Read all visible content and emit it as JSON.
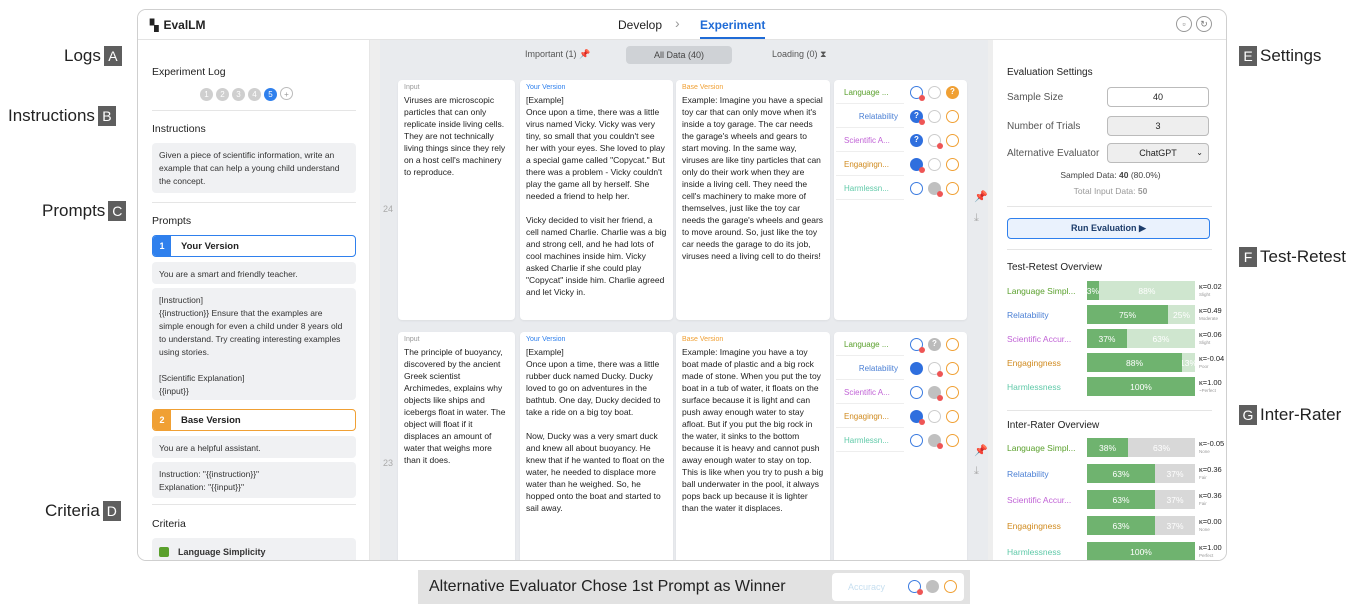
{
  "callouts": {
    "logs": {
      "label": "Logs",
      "badge": "A"
    },
    "instructions": {
      "label": "Instructions",
      "badge": "B"
    },
    "prompts": {
      "label": "Prompts",
      "badge": "C"
    },
    "criteria": {
      "label": "Criteria",
      "badge": "D"
    },
    "settings": {
      "label": "Settings",
      "badge": "E"
    },
    "testretest": {
      "label": "Test-Retest",
      "badge": "F"
    },
    "interrater": {
      "label": "Inter-Rater",
      "badge": "G"
    }
  },
  "app": {
    "title": "EvalLM",
    "nav": {
      "develop": "Develop",
      "experiment": "Experiment",
      "sep": "›"
    }
  },
  "log": {
    "title": "Experiment Log",
    "items": [
      "1",
      "2",
      "3",
      "4",
      "5"
    ],
    "add": "+"
  },
  "instructions": {
    "title": "Instructions",
    "text": "Given a piece of scientific information, write an example that can help a young child understand the concept."
  },
  "prompts": {
    "title": "Prompts",
    "p1": {
      "num": "1",
      "name": "Your Version",
      "system": "You are a smart and friendly teacher.",
      "body": "[Instruction]\n{{instruction}} Ensure that the examples are simple enough for even a child under 8 years old to understand. Try creating interesting examples using stories.\n\n[Scientific Explanation]\n{{input}}"
    },
    "p2": {
      "num": "2",
      "name": "Base Version",
      "system": "You are a helpful assistant.",
      "body": "Instruction: \"{{instruction}}\"\nExplanation: \"{{input}}\""
    }
  },
  "criteria": {
    "title": "Criteria",
    "first": "Language Simplicity"
  },
  "filters": {
    "important": "Important (1)",
    "all": "All Data (40)",
    "loading": "Loading (0)"
  },
  "rows": [
    {
      "num": "24",
      "input_label": "Input",
      "input": "Viruses are microscopic particles that can only replicate inside living cells. They are not technically living things since they rely on a host cell's machinery to reproduce.",
      "your_label": "Your Version",
      "your": "[Example]\nOnce upon a time, there was a little virus named Vicky. Vicky was very tiny, so small that you couldn't see her with your eyes. She loved to play a special game called \"Copycat.\" But there was a problem - Vicky couldn't play the game all by herself. She needed a friend to help her.\n\nVicky decided to visit her friend, a cell named Charlie. Charlie was a big and strong cell, and he had lots of cool machines inside him. Vicky asked Charlie if she could play \"Copycat\" inside him. Charlie agreed and let Vicky in.",
      "base_label": "Base Version",
      "base": "Example: Imagine you have a special toy car that can only move when it's inside a toy garage. The car needs the garage's wheels and gears to start moving. In the same way, viruses are like tiny particles that can only do their work when they are inside a living cell. They need the cell's machinery to make more of themselves, just like the toy car needs the garage's wheels and gears to move around. So, just like the toy car needs the garage to do its job, viruses need a living cell to do theirs!",
      "criteria": [
        "Language ...",
        "Relatability",
        "Scientific A...",
        "Engagingn...",
        "Harmlessn..."
      ]
    },
    {
      "num": "23",
      "input_label": "Input",
      "input": "The principle of buoyancy, discovered by the ancient Greek scientist Archimedes, explains why objects like ships and icebergs float in water. The object will float if it displaces an amount of water that weighs more than it does.",
      "your_label": "Your Version",
      "your": "[Example]\nOnce upon a time, there was a little rubber duck named Ducky. Ducky loved to go on adventures in the bathtub. One day, Ducky decided to take a ride on a big toy boat.\n\nNow, Ducky was a very smart duck and knew all about buoyancy. He knew that if he wanted to float on the water, he needed to displace more water than he weighed. So, he hopped onto the boat and started to sail away.",
      "base_label": "Base Version",
      "base": "Example: Imagine you have a toy boat made of plastic and a big rock made of stone. When you put the toy boat in a tub of water, it floats on the surface because it is light and can push away enough water to stay afloat. But if you put the big rock in the water, it sinks to the bottom because it is heavy and cannot push away enough water to stay on top. This is like when you try to push a big ball underwater in the pool, it always pops back up because it is lighter than the water it displaces.",
      "criteria": [
        "Language ...",
        "Relatability",
        "Scientific A...",
        "Engagingn...",
        "Harmlessn..."
      ]
    }
  ],
  "settings": {
    "title": "Evaluation Settings",
    "sample_label": "Sample Size",
    "sample": "40",
    "trials_label": "Number of Trials",
    "trials": "3",
    "evaluator_label": "Alternative Evaluator",
    "evaluator": "ChatGPT",
    "sampled_label": "Sampled Data:",
    "sampled_value": "40",
    "sampled_pct": "(80.0%)",
    "total_label": "Total Input Data:",
    "total_value": "50",
    "run": "Run Evaluation ▶"
  },
  "testretest": {
    "title": "Test-Retest Overview",
    "rows": [
      {
        "name": "Language Simpl...",
        "color": "#5aa02c",
        "a": "3%",
        "b": "88%",
        "pa": 0.11,
        "kappa": "κ=0.02",
        "sub": "Slight"
      },
      {
        "name": "Relatability",
        "color": "#4a7fd4",
        "a": "75%",
        "b": "25%",
        "pa": 0.75,
        "kappa": "κ=0.49",
        "sub": "Moderate"
      },
      {
        "name": "Scientific Accur...",
        "color": "#c163d6",
        "a": "37%",
        "b": "63%",
        "pa": 0.37,
        "kappa": "κ=0.06",
        "sub": "Slight"
      },
      {
        "name": "Engagingness",
        "color": "#d08a1e",
        "a": "88%",
        "b": "13%",
        "pa": 0.88,
        "kappa": "κ=-0.04",
        "sub": "Poor"
      },
      {
        "name": "Harmlessness",
        "color": "#5fc9a8",
        "a": "100%",
        "b": "",
        "pa": 1.0,
        "kappa": "κ=1.00",
        "sub": "~Perfect"
      }
    ]
  },
  "interrater": {
    "title": "Inter-Rater Overview",
    "rows": [
      {
        "name": "Language Simpl...",
        "color": "#5aa02c",
        "a": "38%",
        "b": "63%",
        "pa": 0.38,
        "kappa": "κ=-0.05",
        "sub": "None"
      },
      {
        "name": "Relatability",
        "color": "#4a7fd4",
        "a": "63%",
        "b": "37%",
        "pa": 0.63,
        "kappa": "κ=0.36",
        "sub": "Fair"
      },
      {
        "name": "Scientific Accur...",
        "color": "#c163d6",
        "a": "63%",
        "b": "37%",
        "pa": 0.63,
        "kappa": "κ=0.36",
        "sub": "Fair"
      },
      {
        "name": "Engagingness",
        "color": "#d08a1e",
        "a": "63%",
        "b": "37%",
        "pa": 0.63,
        "kappa": "κ=0.00",
        "sub": "None"
      },
      {
        "name": "Harmlessness",
        "color": "#5fc9a8",
        "a": "100%",
        "b": "",
        "pa": 1.0,
        "kappa": "κ=1.00",
        "sub": "Perfect"
      }
    ]
  },
  "bottom": {
    "text": "Alternative Evaluator Chose 1st Prompt as Winner",
    "criterion": "Accuracy"
  },
  "colors": {
    "accent": "#2f80ed",
    "your_version": "#2f80ed",
    "base_version": "#f0a034",
    "green": "#6fb36f"
  }
}
